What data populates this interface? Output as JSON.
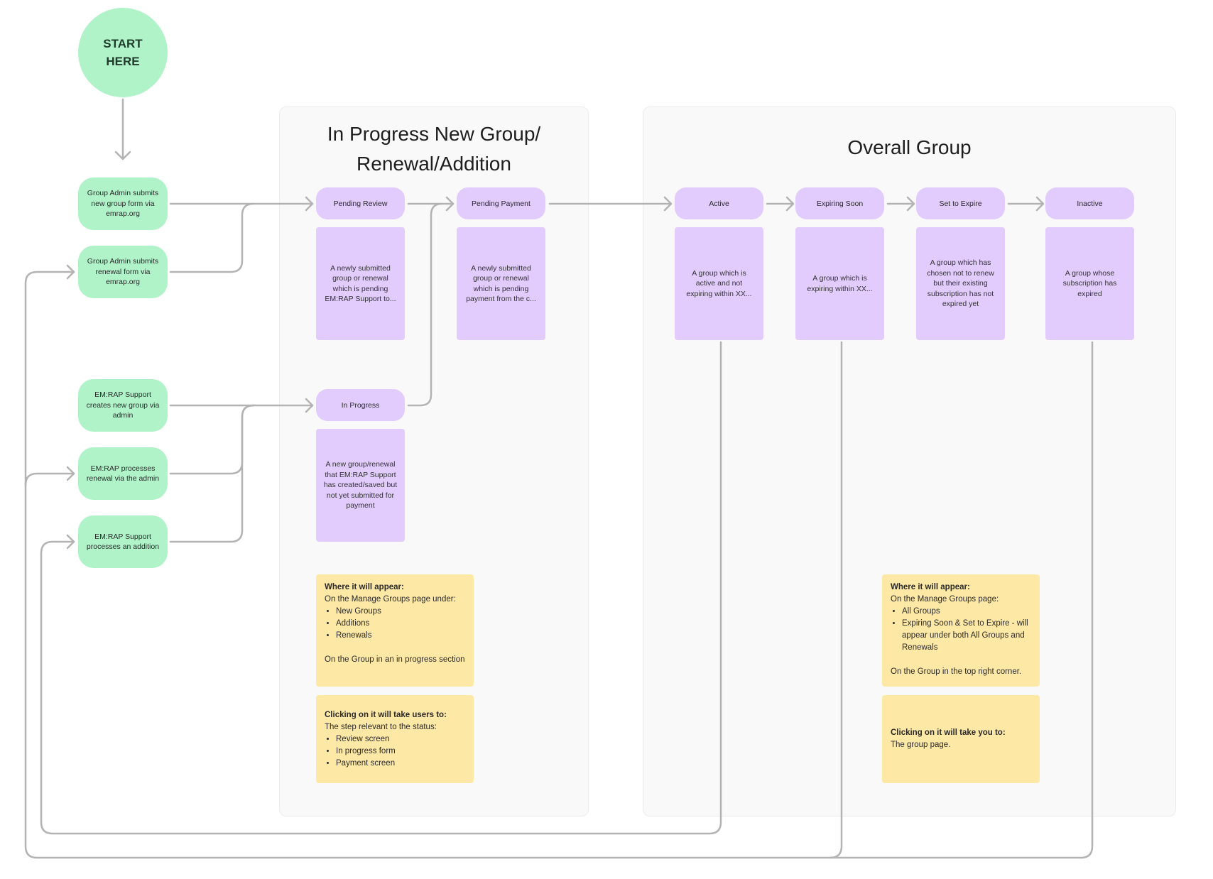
{
  "start": {
    "label": "START\nHERE",
    "color": "#b0f3c9"
  },
  "triggers": [
    {
      "id": "admin-new",
      "label": "Group Admin submits new group form via emrap.org"
    },
    {
      "id": "admin-renewal",
      "label": "Group Admin submits renewal form via emrap.org"
    },
    {
      "id": "support-new",
      "label": "EM:RAP Support creates new group via admin"
    },
    {
      "id": "support-renewal",
      "label": "EM:RAP processes renewal via the admin"
    },
    {
      "id": "support-addition",
      "label": "EM:RAP Support processes an addition"
    }
  ],
  "in_progress_section": {
    "title_line1": "In Progress New Group/",
    "title_line2": "Renewal/Addition",
    "statuses": [
      {
        "label": "Pending Review",
        "description": "A newly submitted group or renewal which is pending EM:RAP Support to..."
      },
      {
        "label": "Pending Payment",
        "description": "A newly submitted group or renewal which is pending payment from the c..."
      },
      {
        "label": "In Progress",
        "description": "A new group/renewal that EM:RAP Support has created/saved but not yet submitted for payment"
      }
    ],
    "where_note": {
      "heading": "Where it will appear:",
      "intro": "On the Manage Groups page under:",
      "items": [
        "New Groups",
        "Additions",
        "Renewals"
      ],
      "footer": "On the Group in an in progress section"
    },
    "click_note": {
      "heading": "Clicking on it will take users to:",
      "intro": "The step relevant to the status:",
      "items": [
        "Review screen",
        "In progress form",
        "Payment screen"
      ]
    }
  },
  "overall_section": {
    "title": "Overall Group",
    "statuses": [
      {
        "label": "Active",
        "description": "A group which is active and not expiring within XX..."
      },
      {
        "label": "Expiring Soon",
        "description": "A group which is expiring within XX..."
      },
      {
        "label": "Set to Expire",
        "description": "A group which has chosen not to renew but their existing subscription has not expired yet"
      },
      {
        "label": "Inactive",
        "description": "A group whose subscription has expired"
      }
    ],
    "where_note": {
      "heading": "Where it will appear:",
      "intro": "On the Manage Groups page:",
      "items": [
        "All Groups",
        "Expiring Soon & Set to Expire - will appear under both All Groups and Renewals"
      ],
      "footer": "On the Group in the top right corner."
    },
    "click_note": {
      "heading": "Clicking on it will take you to:",
      "intro": "The group page."
    }
  },
  "colors": {
    "trigger": "#b0f3c9",
    "status": "#e2cbfd",
    "note": "#fde8a6",
    "connector": "#b3b3b3",
    "section_bg": "#f9f9f9"
  }
}
